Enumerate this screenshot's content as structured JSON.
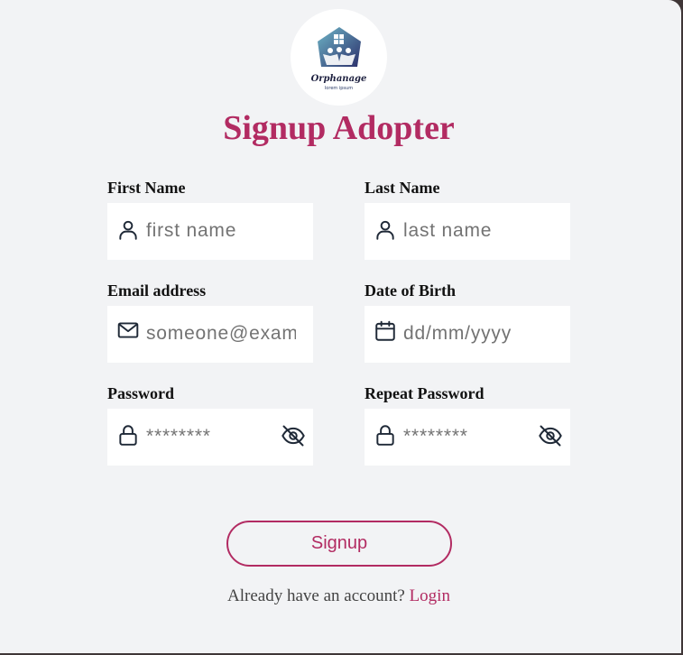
{
  "logo": {
    "name": "Orphanage",
    "tagline": "lorem ipsum"
  },
  "title": "Signup Adopter",
  "fields": {
    "first_name": {
      "label": "First Name",
      "placeholder": "first name",
      "icon": "user-icon"
    },
    "last_name": {
      "label": "Last Name",
      "placeholder": "last name",
      "icon": "user-icon"
    },
    "email": {
      "label": "Email address",
      "placeholder": "someone@example.com",
      "icon": "mail-icon"
    },
    "dob": {
      "label": "Date of Birth",
      "placeholder": "dd/mm/yyyy",
      "icon": "calendar-icon"
    },
    "password": {
      "label": "Password",
      "placeholder": "********",
      "icon": "lock-icon",
      "toggle_icon": "eye-off-icon"
    },
    "repeat_password": {
      "label": "Repeat Password",
      "placeholder": "********",
      "icon": "lock-icon",
      "toggle_icon": "eye-off-icon"
    }
  },
  "submit_label": "Signup",
  "footer": {
    "prompt": "Already have an account?",
    "login_link": "Login"
  },
  "colors": {
    "accent": "#b22b62",
    "background": "#f2f3f5",
    "field_bg": "#ffffff",
    "outer": "#3f3637"
  }
}
